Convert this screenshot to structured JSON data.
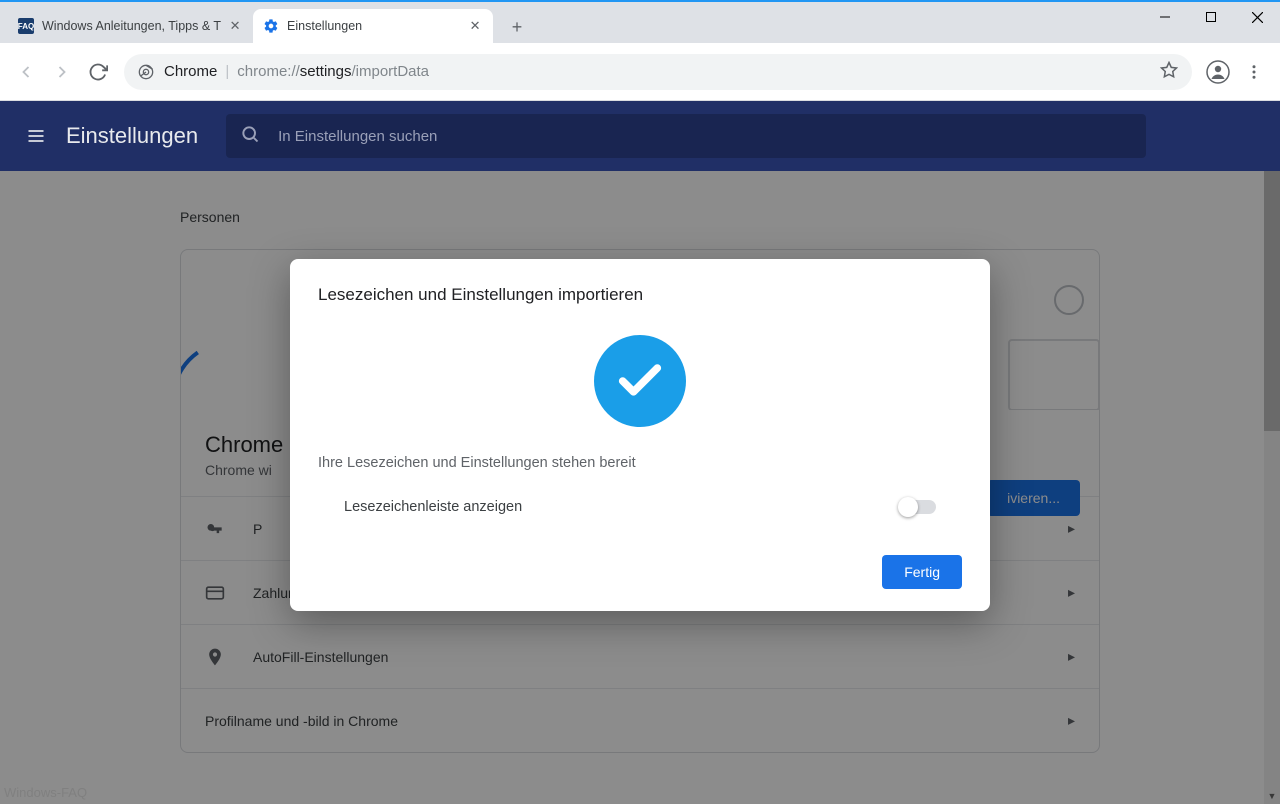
{
  "window": {
    "tabs": [
      {
        "title": "Windows Anleitungen, Tipps & T",
        "active": false
      },
      {
        "title": "Einstellungen",
        "active": true
      }
    ]
  },
  "omnibox": {
    "prefix": "Chrome",
    "url_gray1": "chrome://",
    "url_dark": "settings",
    "url_gray2": "/importData"
  },
  "settings": {
    "header_title": "Einstellungen",
    "search_placeholder": "In Einstellungen suchen",
    "section_title": "Personen",
    "card": {
      "heading": "Chrome",
      "subtext": "Chrome wi",
      "sync_button": "ivieren..."
    },
    "rows": {
      "r1": "P",
      "r2": "Zahlungsmethoden",
      "r3": "AutoFill-Einstellungen",
      "r4": "Profilname und -bild in Chrome"
    }
  },
  "modal": {
    "title": "Lesezeichen und Einstellungen importieren",
    "message": "Ihre Lesezeichen und Einstellungen stehen bereit",
    "toggle_label": "Lesezeichenleiste anzeigen",
    "done": "Fertig"
  },
  "watermark": "Windows-FAQ"
}
